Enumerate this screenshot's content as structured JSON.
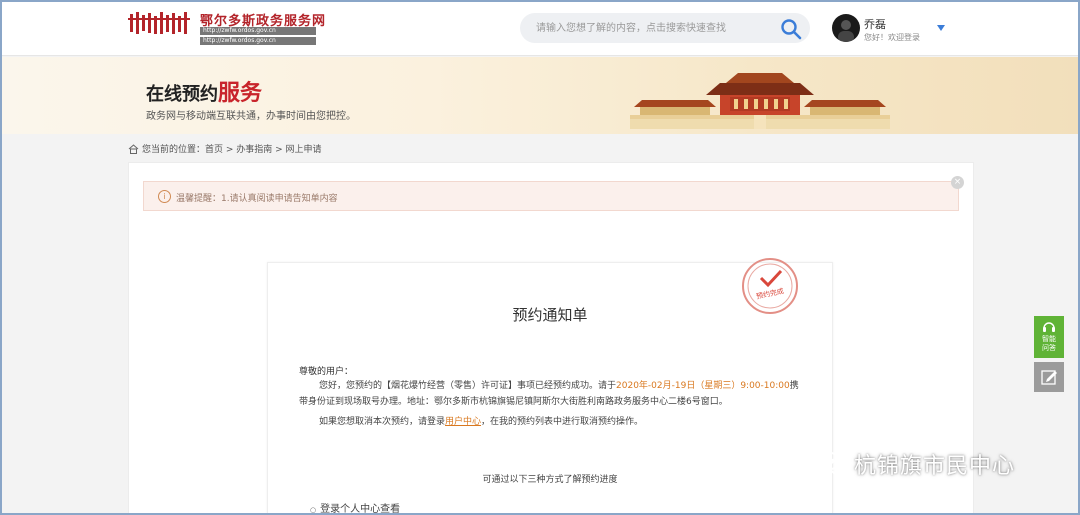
{
  "header": {
    "site_title": "鄂尔多斯政务服务网",
    "site_sub_line1": "http://zwfw.ordos.gov.cn",
    "site_sub_line2": "http://zwfw.ordos.gov.cn",
    "search_placeholder": "请输入您想了解的内容，点击搜索快速查找",
    "user_name": "乔磊",
    "user_sub": "您好！欢迎登录"
  },
  "banner": {
    "title_part1": "在线预约",
    "title_part2": "服务",
    "subtitle": "政务网与移动端互联共通，办事时间由您把控。"
  },
  "breadcrumb": {
    "text": "您当前的位置：首页 > 办事指南 > 网上申请"
  },
  "notice": {
    "icon": "i",
    "text": "温馨提醒：1.请认真阅读申请告知单内容",
    "close": "×"
  },
  "form": {
    "stamp_text": "预约完成",
    "title": "预约通知单",
    "greeting": "尊敬的用户：",
    "p1_pre": "您好，您预约的【烟花爆竹经营（零售）许可证】事项已经预约成功。请于",
    "p1_date": "2020年-02月-19日（星期三）9:00-10:00",
    "p1_post": "携带身份证到现场取号办理。地址：鄂尔多斯市杭锦旗锡尼镇阿斯尔大街胜利南路政务服务中心二楼6号窗口。",
    "p2_pre": "如果您想取消本次预约，请登录",
    "p2_link": "用户中心",
    "p2_post": "，在我的预约列表中进行取消预约操作。",
    "methods_title": "可通过以下三种方式了解预约进度",
    "method_1": "登录个人中心查看"
  },
  "side": {
    "ai_label_1": "智能",
    "ai_label_2": "问答"
  },
  "watermark": {
    "text": "杭锦旗市民中心"
  },
  "colors": {
    "brand_red": "#c8242b",
    "highlight_orange": "#d9781f",
    "search_blue": "#3b7dd8",
    "side_green": "#5fb336"
  }
}
